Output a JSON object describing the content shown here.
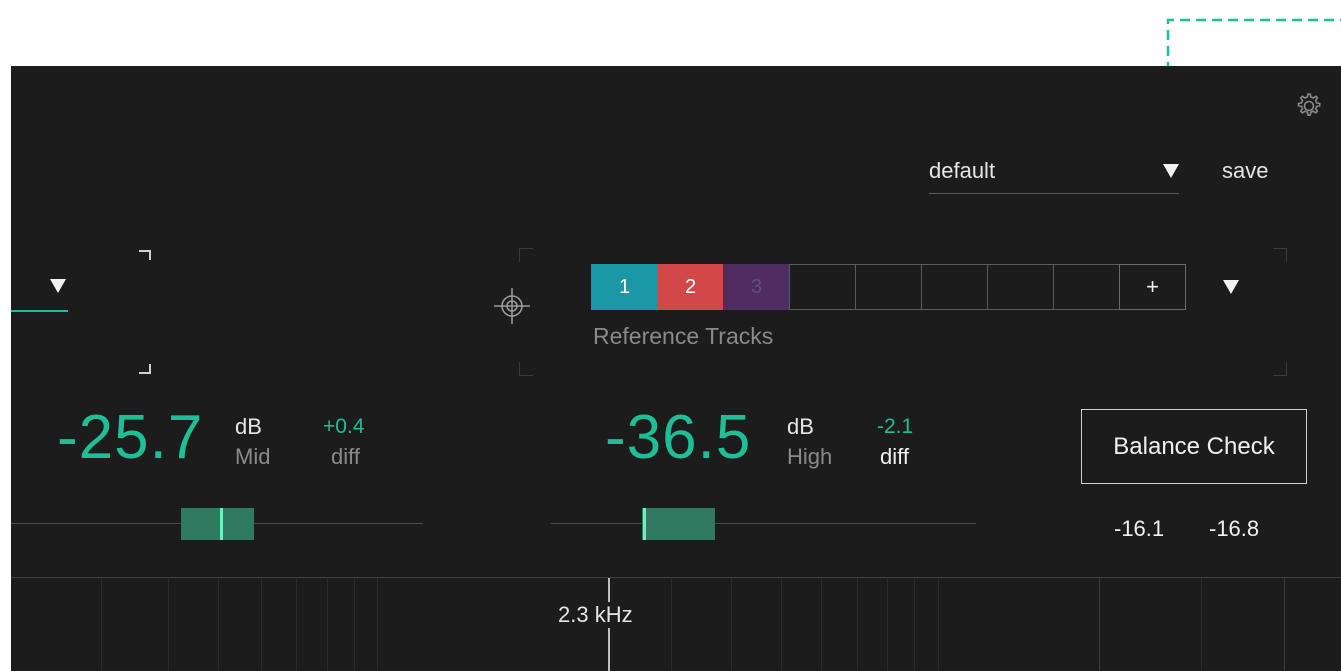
{
  "header": {
    "preset_name": "default",
    "save_label": "save"
  },
  "reference": {
    "tracks": [
      {
        "label": "1",
        "color": "#1a98a6"
      },
      {
        "label": "2",
        "color": "#d24848"
      },
      {
        "label": "3",
        "color": "#4f2d63"
      }
    ],
    "empty_slots": 5,
    "add_label": "+",
    "title": "Reference Tracks"
  },
  "meters": {
    "mid": {
      "value": "-25.7",
      "unit": "dB",
      "band": "Mid",
      "diff_value": "+0.4",
      "diff_label": "diff"
    },
    "high": {
      "value": "-36.5",
      "unit": "dB",
      "band": "High",
      "diff_value": "-2.1",
      "diff_label": "diff"
    }
  },
  "balance": {
    "button_label": "Balance Check",
    "value_left": "-16.1",
    "value_right": "-16.8"
  },
  "spectrum": {
    "frequency_label": "2.3 kHz"
  },
  "colors": {
    "accent": "#1fbf95",
    "background": "#1c1c1c"
  },
  "icons": [
    "gear-icon",
    "dropdown-icon",
    "target-icon",
    "annotation-arrow-icon"
  ]
}
